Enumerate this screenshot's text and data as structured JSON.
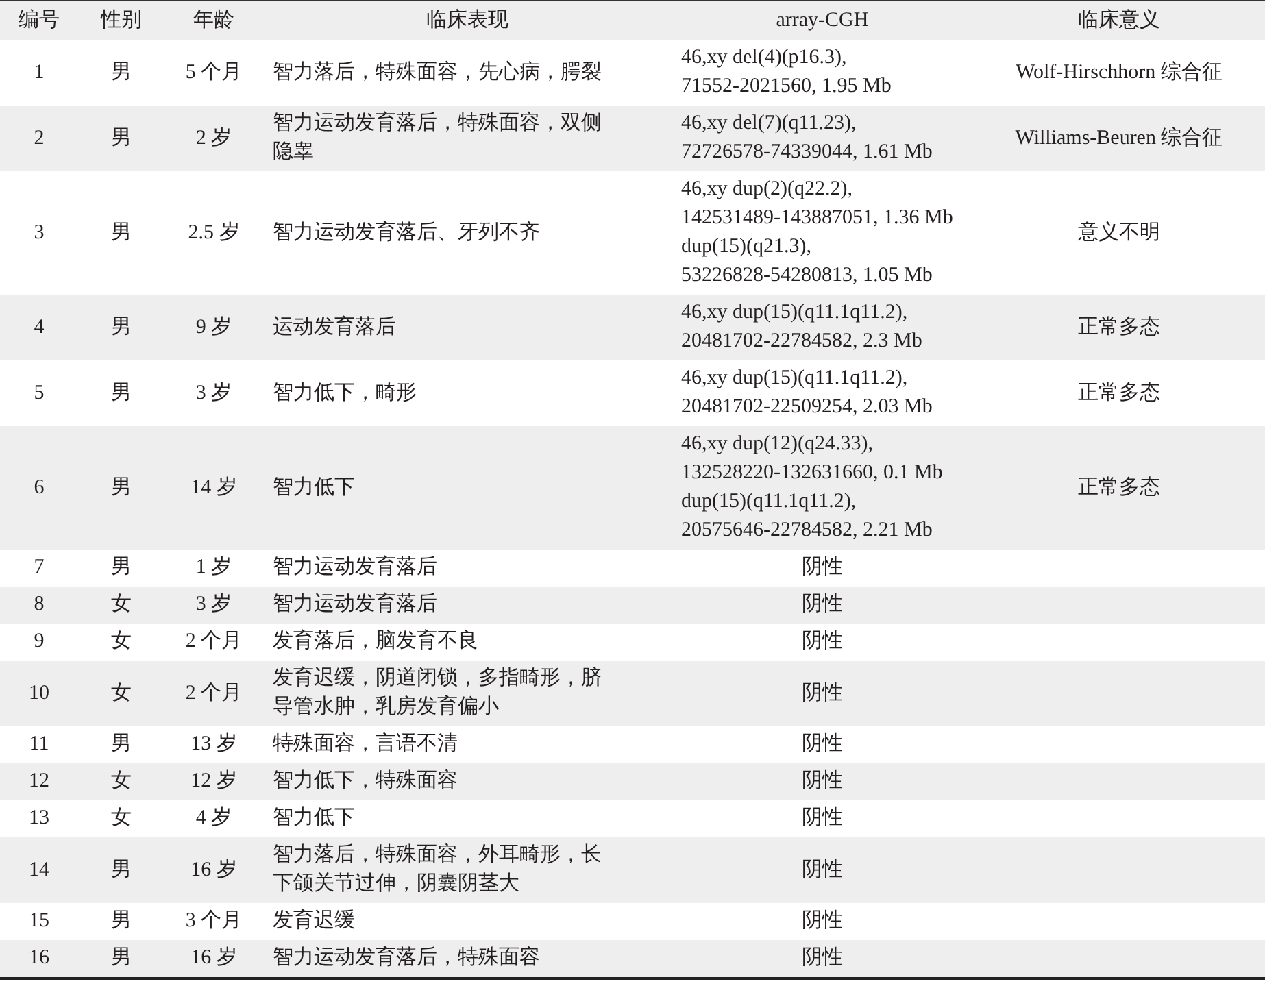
{
  "table": {
    "columns": [
      "编号",
      "性别",
      "年龄",
      "临床表现",
      "array-CGH",
      "临床意义"
    ],
    "rows": [
      {
        "kind": "finding",
        "id": "1",
        "sex": "男",
        "age": "5 个月",
        "presentation": "智力落后，特殊面容，先心病，腭裂",
        "cgh": [
          "46,xy del(4)(p16.3),",
          "71552-2021560, 1.95 Mb"
        ],
        "significance": "Wolf-Hirschhorn 综合征"
      },
      {
        "kind": "finding",
        "id": "2",
        "sex": "男",
        "age": "2 岁",
        "presentation": "智力运动发育落后，特殊面容，双侧隐睾",
        "cgh": [
          "46,xy del(7)(q11.23),",
          "72726578-74339044, 1.61 Mb"
        ],
        "significance": "Williams-Beuren 综合征"
      },
      {
        "kind": "finding",
        "id": "3",
        "sex": "男",
        "age": "2.5 岁",
        "presentation": "智力运动发育落后、牙列不齐",
        "cgh": [
          "46,xy dup(2)(q22.2),",
          "142531489-143887051, 1.36 Mb",
          "dup(15)(q21.3),",
          "53226828-54280813, 1.05 Mb"
        ],
        "significance": "意义不明"
      },
      {
        "kind": "finding",
        "id": "4",
        "sex": "男",
        "age": "9 岁",
        "presentation": "运动发育落后",
        "cgh": [
          "46,xy dup(15)(q11.1q11.2),",
          "20481702-22784582, 2.3 Mb"
        ],
        "significance": "正常多态"
      },
      {
        "kind": "finding",
        "id": "5",
        "sex": "男",
        "age": "3 岁",
        "presentation": "智力低下，畸形",
        "cgh": [
          "46,xy dup(15)(q11.1q11.2),",
          "20481702-22509254, 2.03 Mb"
        ],
        "significance": "正常多态"
      },
      {
        "kind": "finding",
        "id": "6",
        "sex": "男",
        "age": "14 岁",
        "presentation": "智力低下",
        "cgh": [
          "46,xy dup(12)(q24.33),",
          "132528220-132631660, 0.1 Mb",
          "dup(15)(q11.1q11.2),",
          "20575646-22784582, 2.21 Mb"
        ],
        "significance": "正常多态"
      },
      {
        "kind": "negative",
        "id": "7",
        "sex": "男",
        "age": "1 岁",
        "presentation": "智力运动发育落后",
        "cgh": [
          "阴性"
        ]
      },
      {
        "kind": "negative",
        "id": "8",
        "sex": "女",
        "age": "3 岁",
        "presentation": "智力运动发育落后",
        "cgh": [
          "阴性"
        ]
      },
      {
        "kind": "negative",
        "id": "9",
        "sex": "女",
        "age": "2 个月",
        "presentation": "发育落后，脑发育不良",
        "cgh": [
          "阴性"
        ]
      },
      {
        "kind": "negative",
        "id": "10",
        "sex": "女",
        "age": "2 个月",
        "presentation": "发育迟缓，阴道闭锁，多指畸形，脐导管水肿，乳房发育偏小",
        "cgh": [
          "阴性"
        ]
      },
      {
        "kind": "negative",
        "id": "11",
        "sex": "男",
        "age": "13 岁",
        "presentation": "特殊面容，言语不清",
        "cgh": [
          "阴性"
        ]
      },
      {
        "kind": "negative",
        "id": "12",
        "sex": "女",
        "age": "12 岁",
        "presentation": "智力低下，特殊面容",
        "cgh": [
          "阴性"
        ]
      },
      {
        "kind": "negative",
        "id": "13",
        "sex": "女",
        "age": "4 岁",
        "presentation": "智力低下",
        "cgh": [
          "阴性"
        ]
      },
      {
        "kind": "negative",
        "id": "14",
        "sex": "男",
        "age": "16 岁",
        "presentation": "智力落后，特殊面容，外耳畸形，长下颌关节过伸，阴囊阴茎大",
        "cgh": [
          "阴性"
        ]
      },
      {
        "kind": "negative",
        "id": "15",
        "sex": "男",
        "age": "3 个月",
        "presentation": "发育迟缓",
        "cgh": [
          "阴性"
        ]
      },
      {
        "kind": "negative",
        "id": "16",
        "sex": "男",
        "age": "16 岁",
        "presentation": "智力运动发育落后，特殊面容",
        "cgh": [
          "阴性"
        ]
      }
    ]
  }
}
